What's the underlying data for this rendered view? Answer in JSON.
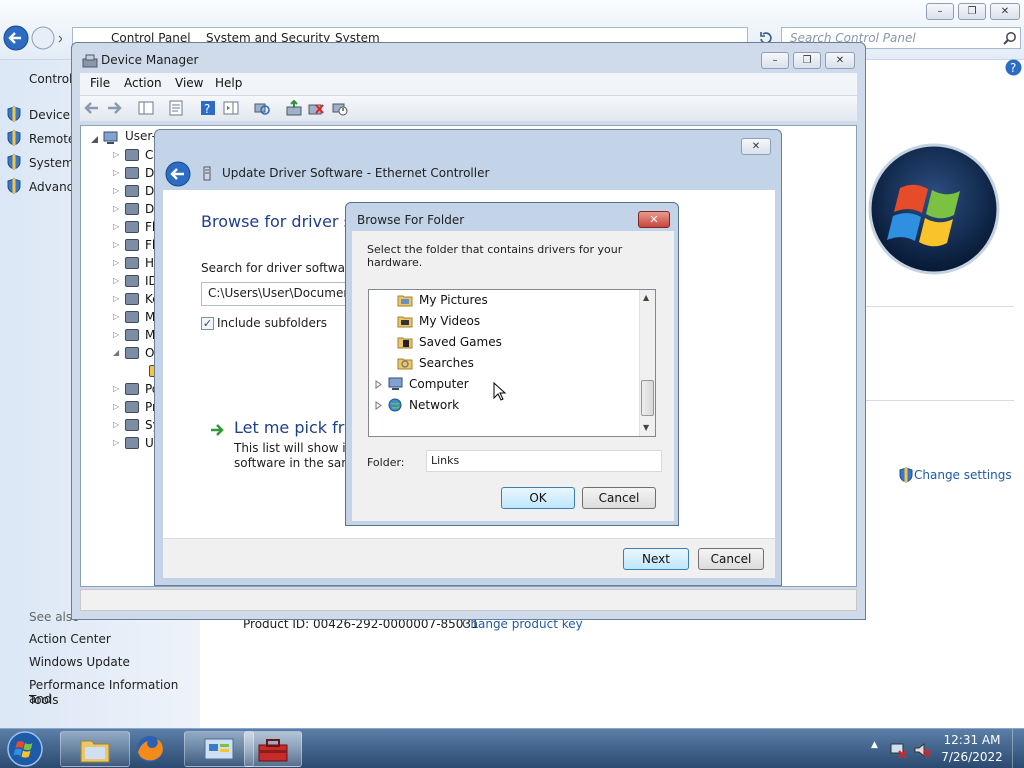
{
  "control_panel": {
    "breadcrumbs": [
      "Control Panel",
      "System and Security",
      "System"
    ],
    "search_placeholder": "Search Control Panel",
    "left_title": "Control",
    "left_links": [
      "Device M",
      "Remote",
      "System",
      "Advanc"
    ],
    "see_also_title": "See also",
    "see_also_links": [
      "Action Center",
      "Windows Update",
      "Performance Information and",
      "Tools"
    ],
    "product_id": "Product ID: 00426-292-0000007-85031",
    "change_product_key": "Change product key",
    "change_settings": "Change settings"
  },
  "device_manager": {
    "title": "Device Manager",
    "menu": [
      "File",
      "Action",
      "View",
      "Help"
    ],
    "tree_root": "User-I",
    "tree_items": [
      "Co",
      "Di",
      "Di",
      "DV",
      "Fl",
      "Fl",
      "Hu",
      "ID",
      "Ke",
      "M",
      "M",
      "Ot",
      "",
      "Po",
      "Pr",
      "Sy",
      "Ur"
    ]
  },
  "wizard": {
    "title": "Update Driver Software - Ethernet Controller",
    "heading": "Browse for driver sof",
    "search_label": "Search for driver software in",
    "path_value": "C:\\Users\\User\\Documents",
    "include_subfolders": "Include subfolders",
    "include_subfolders_checked": true,
    "pick_heading": "Let me pick from",
    "pick_desc_1": "This list will show inst",
    "pick_desc_2": "software in the same",
    "next_label": "Next",
    "cancel_label": "Cancel"
  },
  "browse_folder": {
    "title": "Browse For Folder",
    "instruction": "Select the folder that contains drivers for your hardware.",
    "items": [
      {
        "label": "My Pictures",
        "icon": "pictures-folder-icon"
      },
      {
        "label": "My Videos",
        "icon": "videos-folder-icon"
      },
      {
        "label": "Saved Games",
        "icon": "saved-games-folder-icon"
      },
      {
        "label": "Searches",
        "icon": "searches-folder-icon"
      },
      {
        "label": "Computer",
        "icon": "computer-icon"
      },
      {
        "label": "Network",
        "icon": "network-icon"
      }
    ],
    "folder_label": "Folder:",
    "folder_value": "Links",
    "ok_label": "OK",
    "cancel_label": "Cancel"
  },
  "taskbar": {
    "time": "12:31 AM",
    "date": "7/26/2022"
  },
  "colors": {
    "link": "#1e5aa8",
    "heading": "#1e3f8a",
    "close_red": "#c9453a"
  }
}
